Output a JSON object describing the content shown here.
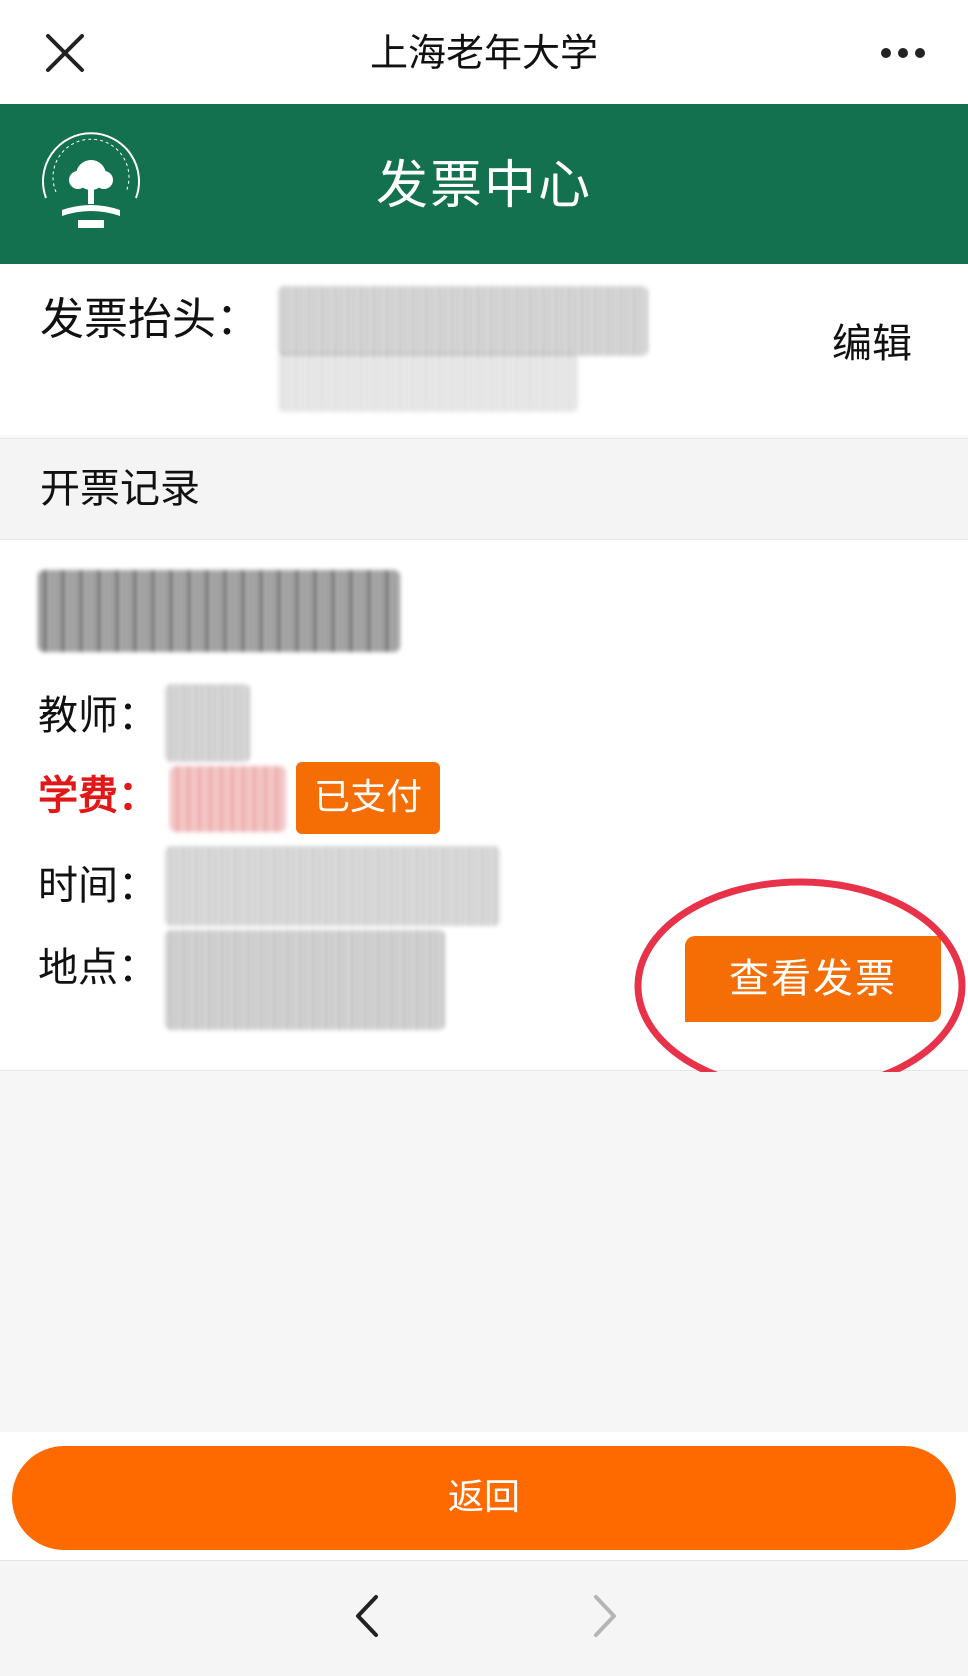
{
  "navbar": {
    "title": "上海老年大学",
    "close_icon": "close-icon",
    "more_icon": "more-horizontal-icon"
  },
  "header": {
    "title": "发票中心",
    "logo_icon": "university-logo-icon",
    "background_color": "#13714f"
  },
  "invoice_title": {
    "label": "发票抬头：",
    "value_redacted": true,
    "edit_label": "编辑"
  },
  "records": {
    "section_title": "开票记录",
    "items": [
      {
        "course_name_redacted": true,
        "teacher_label": "教师：",
        "fee_label": "学费：",
        "status_badge": "已支付",
        "time_label": "时间：",
        "location_label": "地点：",
        "view_invoice_label": "查看发票"
      }
    ]
  },
  "footer": {
    "return_label": "返回"
  },
  "browser_nav": {
    "back_icon": "chevron-left-icon",
    "forward_icon": "chevron-right-icon"
  },
  "colors": {
    "accent": "#f46d05",
    "return_button": "#ff6a00",
    "fee_label": "#e01818",
    "highlight_circle": "#e8324a"
  }
}
